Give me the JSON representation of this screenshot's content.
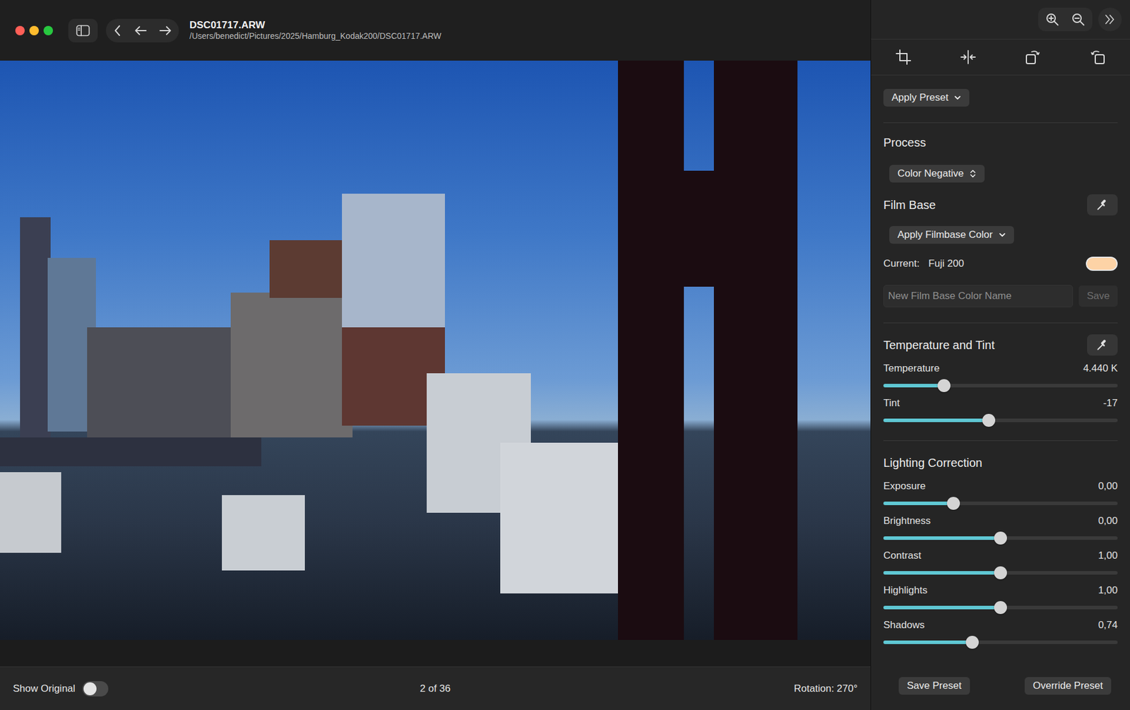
{
  "window": {
    "title": "DSC01717.ARW",
    "path": "/Users/benedict/Pictures/2025/Hamburg_Kodak200/DSC01717.ARW"
  },
  "status_bar": {
    "show_original": {
      "label": "Show Original",
      "on": false
    },
    "counter": "2 of 36",
    "rotation": "Rotation: 270°"
  },
  "panel": {
    "preset_menu": "Apply Preset",
    "process": {
      "title": "Process",
      "value": "Color Negative"
    },
    "film_base": {
      "title": "Film Base",
      "menu": "Apply Filmbase Color",
      "current_label": "Current:",
      "current_value": "Fuji 200",
      "color": "#fdd3a6",
      "name_placeholder": "New Film Base Color Name",
      "save": "Save",
      "save_disabled": true
    },
    "sections": [
      {
        "title": "Temperature and Tint",
        "has_picker": true,
        "sliders": [
          {
            "label": "Temperature",
            "reading": "4.440 K",
            "level": 0.26
          },
          {
            "label": "Tint",
            "reading": "-17",
            "level": 0.45
          }
        ]
      },
      {
        "title": "Lighting Correction",
        "has_picker": false,
        "sliders": [
          {
            "label": "Exposure",
            "reading": "0,00",
            "level": 0.3
          },
          {
            "label": "Brightness",
            "reading": "0,00",
            "level": 0.5
          },
          {
            "label": "Contrast",
            "reading": "1,00",
            "level": 0.5
          },
          {
            "label": "Highlights",
            "reading": "1,00",
            "level": 0.5
          },
          {
            "label": "Shadows",
            "reading": "0,74",
            "level": 0.38
          }
        ]
      }
    ],
    "buttons": [
      "Save Preset",
      "Override Preset"
    ]
  }
}
